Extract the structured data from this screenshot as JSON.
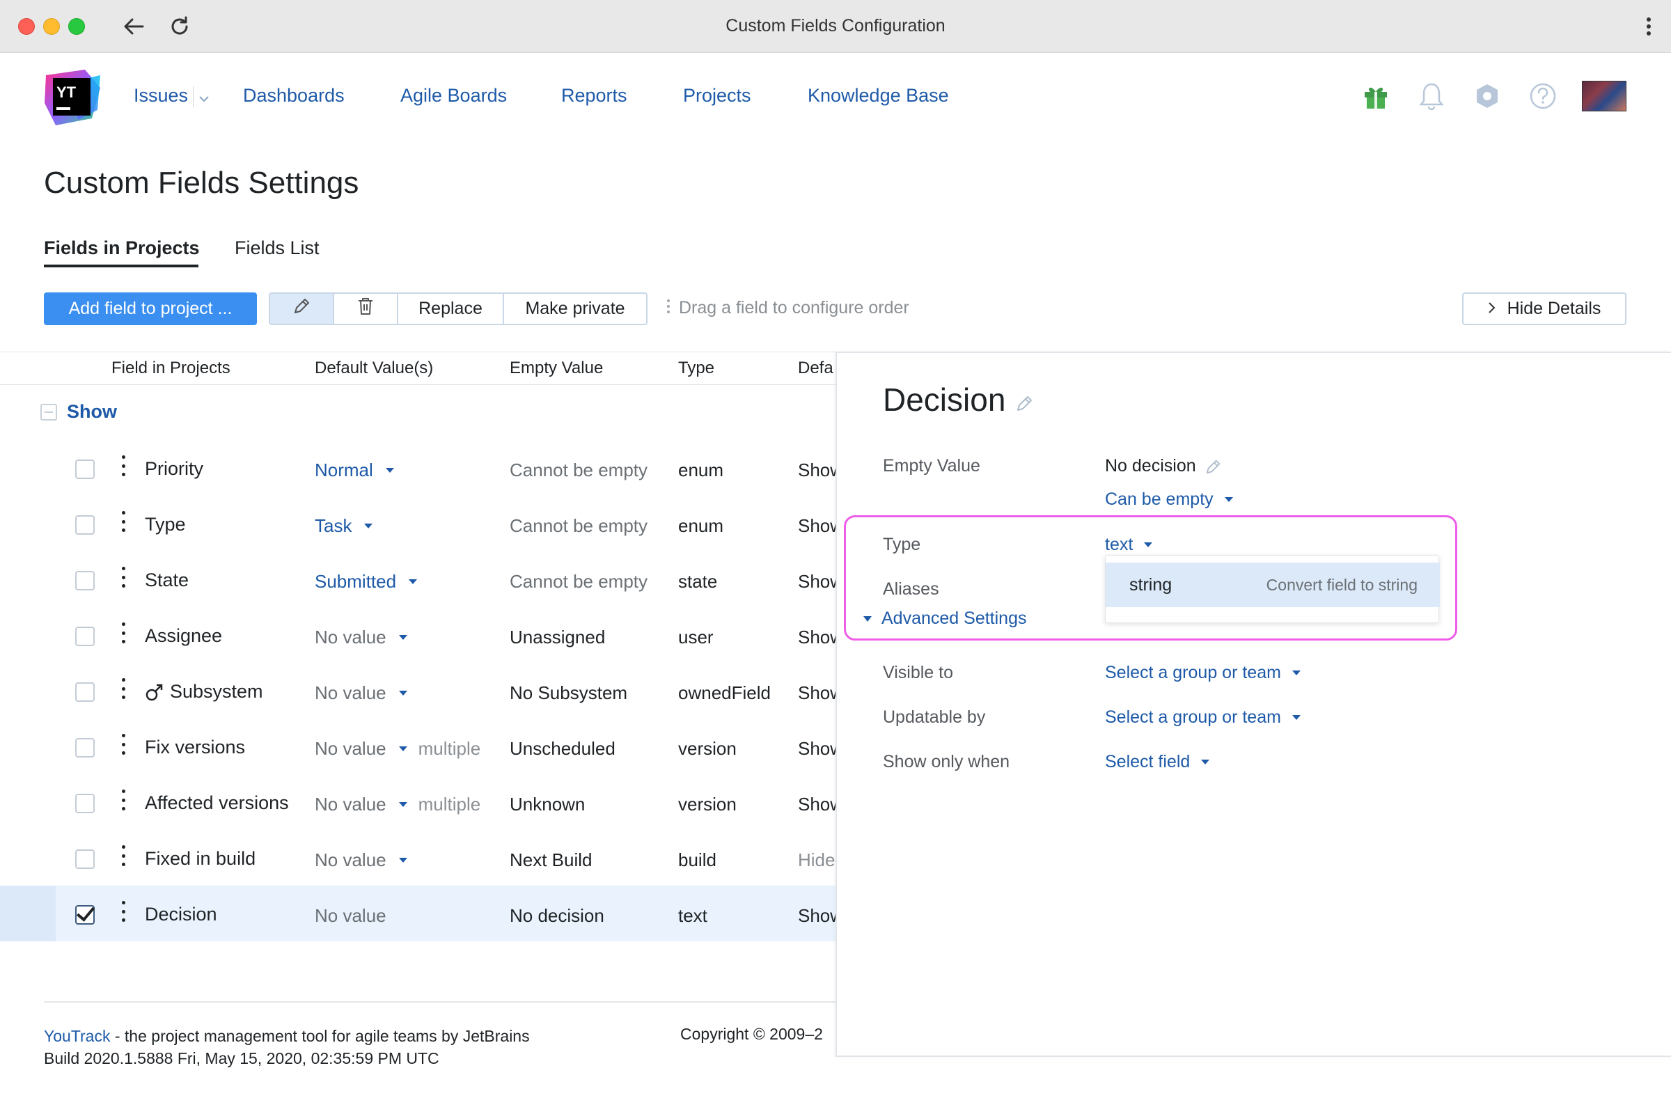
{
  "browser": {
    "title": "Custom Fields Configuration"
  },
  "logo": {
    "text": "YT"
  },
  "nav": {
    "issues": "Issues",
    "dashboards": "Dashboards",
    "agile_boards": "Agile Boards",
    "reports": "Reports",
    "projects": "Projects",
    "knowledge_base": "Knowledge Base"
  },
  "page": {
    "title": "Custom Fields Settings"
  },
  "tabs": {
    "fields_in_projects": "Fields in Projects",
    "fields_list": "Fields List"
  },
  "toolbar": {
    "add_field": "Add field to project ...",
    "replace": "Replace",
    "make_private": "Make private",
    "drag_hint": "Drag a field to configure order",
    "hide_details": "Hide Details"
  },
  "table": {
    "headers": {
      "field": "Field in Projects",
      "default": "Default Value(s)",
      "empty": "Empty Value",
      "type": "Type",
      "visibility": "Defa"
    },
    "group": "Show",
    "rows": [
      {
        "name": "Priority",
        "default": "Normal",
        "default_style": "link",
        "caret": true,
        "multiple": "",
        "empty": "Cannot be empty",
        "empty_muted": true,
        "type": "enum",
        "visibility": "Show",
        "vis_muted": false,
        "owned": false,
        "checked": false
      },
      {
        "name": "Type",
        "default": "Task",
        "default_style": "link",
        "caret": true,
        "multiple": "",
        "empty": "Cannot be empty",
        "empty_muted": true,
        "type": "enum",
        "visibility": "Show",
        "vis_muted": false,
        "owned": false,
        "checked": false
      },
      {
        "name": "State",
        "default": "Submitted",
        "default_style": "link",
        "caret": true,
        "multiple": "",
        "empty": "Cannot be empty",
        "empty_muted": true,
        "type": "state",
        "visibility": "Show",
        "vis_muted": false,
        "owned": false,
        "checked": false
      },
      {
        "name": "Assignee",
        "default": "No value",
        "default_style": "muted",
        "caret": true,
        "multiple": "",
        "empty": "Unassigned",
        "empty_muted": false,
        "type": "user",
        "visibility": "Show",
        "vis_muted": false,
        "owned": false,
        "checked": false
      },
      {
        "name": "Subsystem",
        "default": "No value",
        "default_style": "muted",
        "caret": true,
        "multiple": "",
        "empty": "No Subsystem",
        "empty_muted": false,
        "type": "ownedField",
        "visibility": "Show",
        "vis_muted": false,
        "owned": true,
        "checked": false
      },
      {
        "name": "Fix versions",
        "default": "No value",
        "default_style": "muted",
        "caret": true,
        "multiple": "multiple",
        "empty": "Unscheduled",
        "empty_muted": false,
        "type": "version",
        "visibility": "Show",
        "vis_muted": false,
        "owned": false,
        "checked": false
      },
      {
        "name": "Affected versions",
        "default": "No value",
        "default_style": "muted",
        "caret": true,
        "multiple": "multiple",
        "empty": "Unknown",
        "empty_muted": false,
        "type": "version",
        "visibility": "Show",
        "vis_muted": false,
        "owned": false,
        "checked": false
      },
      {
        "name": "Fixed in build",
        "default": "No value",
        "default_style": "muted",
        "caret": true,
        "multiple": "",
        "empty": "Next Build",
        "empty_muted": false,
        "type": "build",
        "visibility": "Hide",
        "vis_muted": true,
        "owned": false,
        "checked": false
      },
      {
        "name": "Decision",
        "default": "No value",
        "default_style": "muted",
        "caret": false,
        "multiple": "",
        "empty": "No decision",
        "empty_muted": false,
        "type": "text",
        "visibility": "Show",
        "vis_muted": false,
        "owned": false,
        "checked": true
      }
    ]
  },
  "footer": {
    "product_link": "YouTrack",
    "tagline": " - the project management tool for agile teams by JetBrains",
    "build": "Build 2020.1.5888 Fri, May 15, 2020, 02:35:59 PM UTC",
    "copyright": "Copyright © 2009–2"
  },
  "details": {
    "title": "Decision",
    "empty_value_label": "Empty Value",
    "empty_value": "No decision",
    "can_be_empty": "Can be empty",
    "type_label": "Type",
    "type_value": "text",
    "aliases_label": "Aliases",
    "advanced_settings": "Advanced Settings",
    "visible_to_label": "Visible to",
    "visible_to_value": "Select a group or team",
    "updatable_by_label": "Updatable by",
    "updatable_by_value": "Select a group or team",
    "show_only_when_label": "Show only when",
    "show_only_when_value": "Select field",
    "dropdown": {
      "option": "string",
      "hint": "Convert field to string"
    }
  },
  "colors": {
    "accent": "#3a8ff0",
    "link": "#1e5aa8",
    "selection": "#dbe9f9",
    "highlight": "#ee5ee8"
  }
}
